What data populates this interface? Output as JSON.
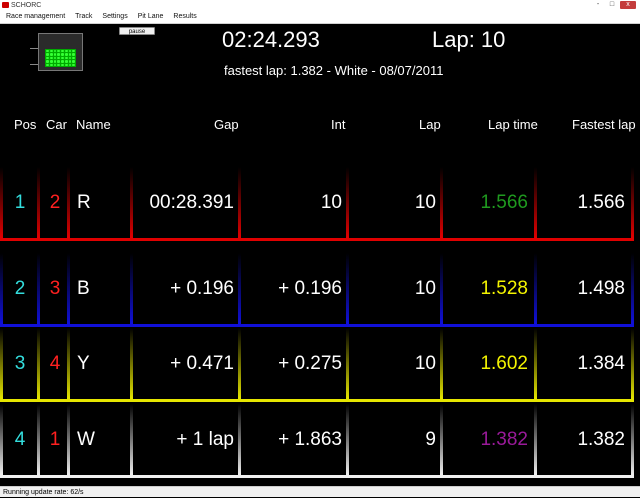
{
  "window": {
    "title": "SCHORC",
    "minimize_icon": "-",
    "maximize_icon": "□",
    "close_icon": "x"
  },
  "menu": [
    "Race management",
    "Track",
    "Settings",
    "Pit Lane",
    "Results"
  ],
  "controls": {
    "pause_label": "pause"
  },
  "race": {
    "time": "02:24.293",
    "lap_label": "Lap: 10",
    "fastest_lap": "fastest lap: 1.382 - White - 08/07/2011"
  },
  "table": {
    "headers": {
      "pos": "Pos",
      "car": "Car",
      "name": "Name",
      "gap": "Gap",
      "int": "Int",
      "lap": "Lap",
      "lap_time": "Lap time",
      "fastest_lap": "Fastest lap"
    },
    "rows": [
      {
        "pos": "1",
        "car": "2",
        "name": "R",
        "gap": "00:28.391",
        "int": "10",
        "lap": "10",
        "lap_time": "1.566",
        "fastest_lap": "1.566",
        "color": "#e00000",
        "lap_time_color": "#1f9a1f"
      },
      {
        "pos": "2",
        "car": "3",
        "name": "B",
        "gap": "+ 0.196",
        "int": "+ 0.196",
        "lap": "10",
        "lap_time": "1.528",
        "fastest_lap": "1.498",
        "color": "#1010d8",
        "lap_time_color": "#f4f400"
      },
      {
        "pos": "3",
        "car": "4",
        "name": "Y",
        "gap": "+ 0.471",
        "int": "+ 0.275",
        "lap": "10",
        "lap_time": "1.602",
        "fastest_lap": "1.384",
        "color": "#e6e600",
        "lap_time_color": "#f4f400"
      },
      {
        "pos": "4",
        "car": "1",
        "name": "W",
        "gap": "+ 1 lap",
        "int": "+ 1.863",
        "lap": "9",
        "lap_time": "1.382",
        "fastest_lap": "1.382",
        "color": "#f0f0f0",
        "lap_time_color": "#9a1a9a"
      }
    ]
  },
  "colors": {
    "pos_text": "#33dddd",
    "car_text": "#ff2020",
    "text": "#ffffff",
    "background": "#000000"
  },
  "status": {
    "text": "Running  update rate: 62/s"
  }
}
